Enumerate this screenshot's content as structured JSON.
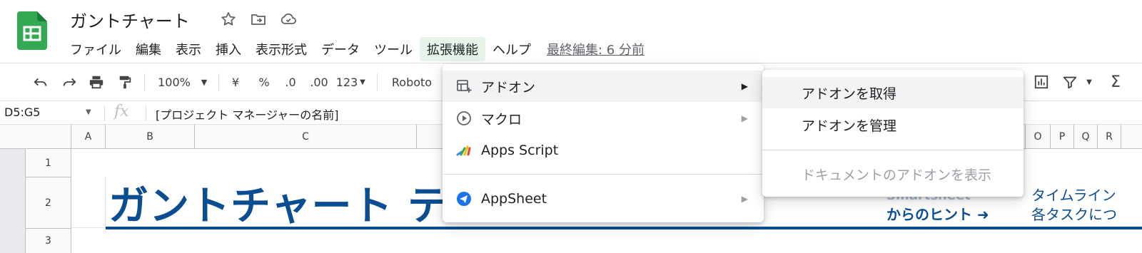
{
  "header": {
    "doc_title": "ガントチャート",
    "last_edit": "最終編集: 6 分前"
  },
  "menubar": {
    "items": [
      "ファイル",
      "編集",
      "表示",
      "挿入",
      "表示形式",
      "データ",
      "ツール",
      "拡張機能",
      "ヘルプ"
    ]
  },
  "toolbar": {
    "zoom": "100%",
    "currency": "¥",
    "percent": "%",
    "dec_decrease": ".0",
    "dec_increase": ".00",
    "format_more": "123",
    "font": "Roboto"
  },
  "formula_bar": {
    "name_box": "D5:G5",
    "fx": "fx",
    "content": "[プロジェクト マネージャーの名前]"
  },
  "grid": {
    "columns": [
      "A",
      "B",
      "C",
      "O",
      "P",
      "Q",
      "R"
    ],
    "rows": [
      "1",
      "2",
      "3"
    ],
    "sheet_title": "ガントチャート テン",
    "hint_line1": "Smartsheet",
    "hint_line2": "からのヒント ➜",
    "side_line1": "タイムライン",
    "side_line2": "各タスクにつ"
  },
  "extensions_menu": {
    "items": [
      {
        "label": "アドオン",
        "icon": "addon-icon",
        "has_submenu": true
      },
      {
        "label": "マクロ",
        "icon": "play-circle-icon",
        "has_submenu": true
      },
      {
        "label": "Apps Script",
        "icon": "apps-script-icon",
        "has_submenu": false
      },
      {
        "label": "AppSheet",
        "icon": "appsheet-icon",
        "has_submenu": true
      }
    ]
  },
  "addon_submenu": {
    "items": [
      {
        "label": "アドオンを取得",
        "enabled": true
      },
      {
        "label": "アドオンを管理",
        "enabled": true
      },
      {
        "label": "ドキュメントのアドオンを表示",
        "enabled": false
      }
    ]
  },
  "colors": {
    "sheets_green": "#34a853",
    "title_blue": "#0b4d91",
    "active_menu_bg": "#e6f4ea"
  }
}
